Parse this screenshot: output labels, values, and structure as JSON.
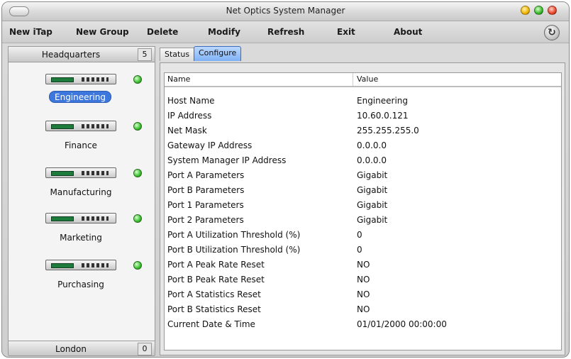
{
  "window": {
    "title": "Net Optics System Manager"
  },
  "menu": {
    "new_itap": "New iTap",
    "new_group": "New Group",
    "delete": "Delete",
    "modify": "Modify",
    "refresh": "Refresh",
    "exit": "Exit",
    "about": "About"
  },
  "sidebar": {
    "group": {
      "name": "Headquarters",
      "count": "5"
    },
    "devices": [
      {
        "label": "Engineering",
        "status": "green"
      },
      {
        "label": "Finance",
        "status": "green"
      },
      {
        "label": "Manufacturing",
        "status": "green"
      },
      {
        "label": "Marketing",
        "status": "green"
      },
      {
        "label": "Purchasing",
        "status": "green"
      }
    ],
    "bottom_group": {
      "name": "London",
      "count": "0"
    }
  },
  "tabs": [
    {
      "label": "Status"
    },
    {
      "label": "Configure"
    }
  ],
  "table": {
    "headers": {
      "name": "Name",
      "value": "Value"
    },
    "rows": [
      {
        "name": "Host Name",
        "value": "Engineering"
      },
      {
        "name": "IP Address",
        "value": "10.60.0.121"
      },
      {
        "name": "Net Mask",
        "value": "255.255.255.0"
      },
      {
        "name": "Gateway IP Address",
        "value": "0.0.0.0"
      },
      {
        "name": "System Manager IP Address",
        "value": "0.0.0.0"
      },
      {
        "name": "Port A Parameters",
        "value": "Gigabit"
      },
      {
        "name": "Port B Parameters",
        "value": "Gigabit"
      },
      {
        "name": "Port 1 Parameters",
        "value": "Gigabit"
      },
      {
        "name": "Port 2 Parameters",
        "value": "Gigabit"
      },
      {
        "name": "Port A Utilization Threshold (%)",
        "value": "0"
      },
      {
        "name": "Port B Utilization Threshold (%)",
        "value": "0"
      },
      {
        "name": "Port A Peak Rate Reset",
        "value": "NO"
      },
      {
        "name": "Port B Peak Rate Reset",
        "value": "NO"
      },
      {
        "name": "Port A Statistics Reset",
        "value": "NO"
      },
      {
        "name": "Port B Statistics Reset",
        "value": "NO"
      },
      {
        "name": "Current Date & Time",
        "value": "01/01/2000 00:00:00"
      }
    ]
  },
  "colors": {
    "selection": "#3d77dd",
    "status_ok": "#36c22a",
    "active_tab": "#7fb1f6"
  }
}
